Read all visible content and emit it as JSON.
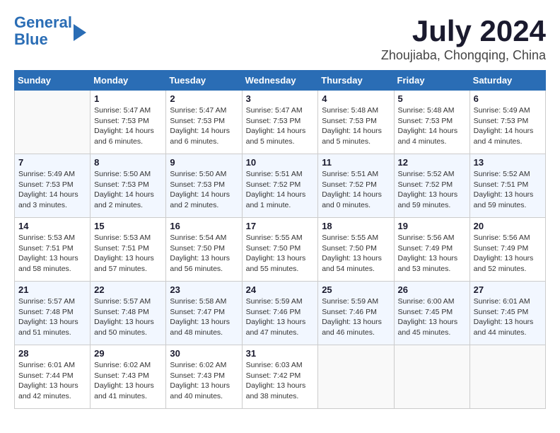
{
  "header": {
    "logo_line1": "General",
    "logo_line2": "Blue",
    "title": "July 2024",
    "subtitle": "Zhoujiaba, Chongqing, China"
  },
  "days_of_week": [
    "Sunday",
    "Monday",
    "Tuesday",
    "Wednesday",
    "Thursday",
    "Friday",
    "Saturday"
  ],
  "weeks": [
    [
      {
        "day": "",
        "info": ""
      },
      {
        "day": "1",
        "info": "Sunrise: 5:47 AM\nSunset: 7:53 PM\nDaylight: 14 hours\nand 6 minutes."
      },
      {
        "day": "2",
        "info": "Sunrise: 5:47 AM\nSunset: 7:53 PM\nDaylight: 14 hours\nand 6 minutes."
      },
      {
        "day": "3",
        "info": "Sunrise: 5:47 AM\nSunset: 7:53 PM\nDaylight: 14 hours\nand 5 minutes."
      },
      {
        "day": "4",
        "info": "Sunrise: 5:48 AM\nSunset: 7:53 PM\nDaylight: 14 hours\nand 5 minutes."
      },
      {
        "day": "5",
        "info": "Sunrise: 5:48 AM\nSunset: 7:53 PM\nDaylight: 14 hours\nand 4 minutes."
      },
      {
        "day": "6",
        "info": "Sunrise: 5:49 AM\nSunset: 7:53 PM\nDaylight: 14 hours\nand 4 minutes."
      }
    ],
    [
      {
        "day": "7",
        "info": "Sunrise: 5:49 AM\nSunset: 7:53 PM\nDaylight: 14 hours\nand 3 minutes."
      },
      {
        "day": "8",
        "info": "Sunrise: 5:50 AM\nSunset: 7:53 PM\nDaylight: 14 hours\nand 2 minutes."
      },
      {
        "day": "9",
        "info": "Sunrise: 5:50 AM\nSunset: 7:53 PM\nDaylight: 14 hours\nand 2 minutes."
      },
      {
        "day": "10",
        "info": "Sunrise: 5:51 AM\nSunset: 7:52 PM\nDaylight: 14 hours\nand 1 minute."
      },
      {
        "day": "11",
        "info": "Sunrise: 5:51 AM\nSunset: 7:52 PM\nDaylight: 14 hours\nand 0 minutes."
      },
      {
        "day": "12",
        "info": "Sunrise: 5:52 AM\nSunset: 7:52 PM\nDaylight: 13 hours\nand 59 minutes."
      },
      {
        "day": "13",
        "info": "Sunrise: 5:52 AM\nSunset: 7:51 PM\nDaylight: 13 hours\nand 59 minutes."
      }
    ],
    [
      {
        "day": "14",
        "info": "Sunrise: 5:53 AM\nSunset: 7:51 PM\nDaylight: 13 hours\nand 58 minutes."
      },
      {
        "day": "15",
        "info": "Sunrise: 5:53 AM\nSunset: 7:51 PM\nDaylight: 13 hours\nand 57 minutes."
      },
      {
        "day": "16",
        "info": "Sunrise: 5:54 AM\nSunset: 7:50 PM\nDaylight: 13 hours\nand 56 minutes."
      },
      {
        "day": "17",
        "info": "Sunrise: 5:55 AM\nSunset: 7:50 PM\nDaylight: 13 hours\nand 55 minutes."
      },
      {
        "day": "18",
        "info": "Sunrise: 5:55 AM\nSunset: 7:50 PM\nDaylight: 13 hours\nand 54 minutes."
      },
      {
        "day": "19",
        "info": "Sunrise: 5:56 AM\nSunset: 7:49 PM\nDaylight: 13 hours\nand 53 minutes."
      },
      {
        "day": "20",
        "info": "Sunrise: 5:56 AM\nSunset: 7:49 PM\nDaylight: 13 hours\nand 52 minutes."
      }
    ],
    [
      {
        "day": "21",
        "info": "Sunrise: 5:57 AM\nSunset: 7:48 PM\nDaylight: 13 hours\nand 51 minutes."
      },
      {
        "day": "22",
        "info": "Sunrise: 5:57 AM\nSunset: 7:48 PM\nDaylight: 13 hours\nand 50 minutes."
      },
      {
        "day": "23",
        "info": "Sunrise: 5:58 AM\nSunset: 7:47 PM\nDaylight: 13 hours\nand 48 minutes."
      },
      {
        "day": "24",
        "info": "Sunrise: 5:59 AM\nSunset: 7:46 PM\nDaylight: 13 hours\nand 47 minutes."
      },
      {
        "day": "25",
        "info": "Sunrise: 5:59 AM\nSunset: 7:46 PM\nDaylight: 13 hours\nand 46 minutes."
      },
      {
        "day": "26",
        "info": "Sunrise: 6:00 AM\nSunset: 7:45 PM\nDaylight: 13 hours\nand 45 minutes."
      },
      {
        "day": "27",
        "info": "Sunrise: 6:01 AM\nSunset: 7:45 PM\nDaylight: 13 hours\nand 44 minutes."
      }
    ],
    [
      {
        "day": "28",
        "info": "Sunrise: 6:01 AM\nSunset: 7:44 PM\nDaylight: 13 hours\nand 42 minutes."
      },
      {
        "day": "29",
        "info": "Sunrise: 6:02 AM\nSunset: 7:43 PM\nDaylight: 13 hours\nand 41 minutes."
      },
      {
        "day": "30",
        "info": "Sunrise: 6:02 AM\nSunset: 7:43 PM\nDaylight: 13 hours\nand 40 minutes."
      },
      {
        "day": "31",
        "info": "Sunrise: 6:03 AM\nSunset: 7:42 PM\nDaylight: 13 hours\nand 38 minutes."
      },
      {
        "day": "",
        "info": ""
      },
      {
        "day": "",
        "info": ""
      },
      {
        "day": "",
        "info": ""
      }
    ]
  ]
}
